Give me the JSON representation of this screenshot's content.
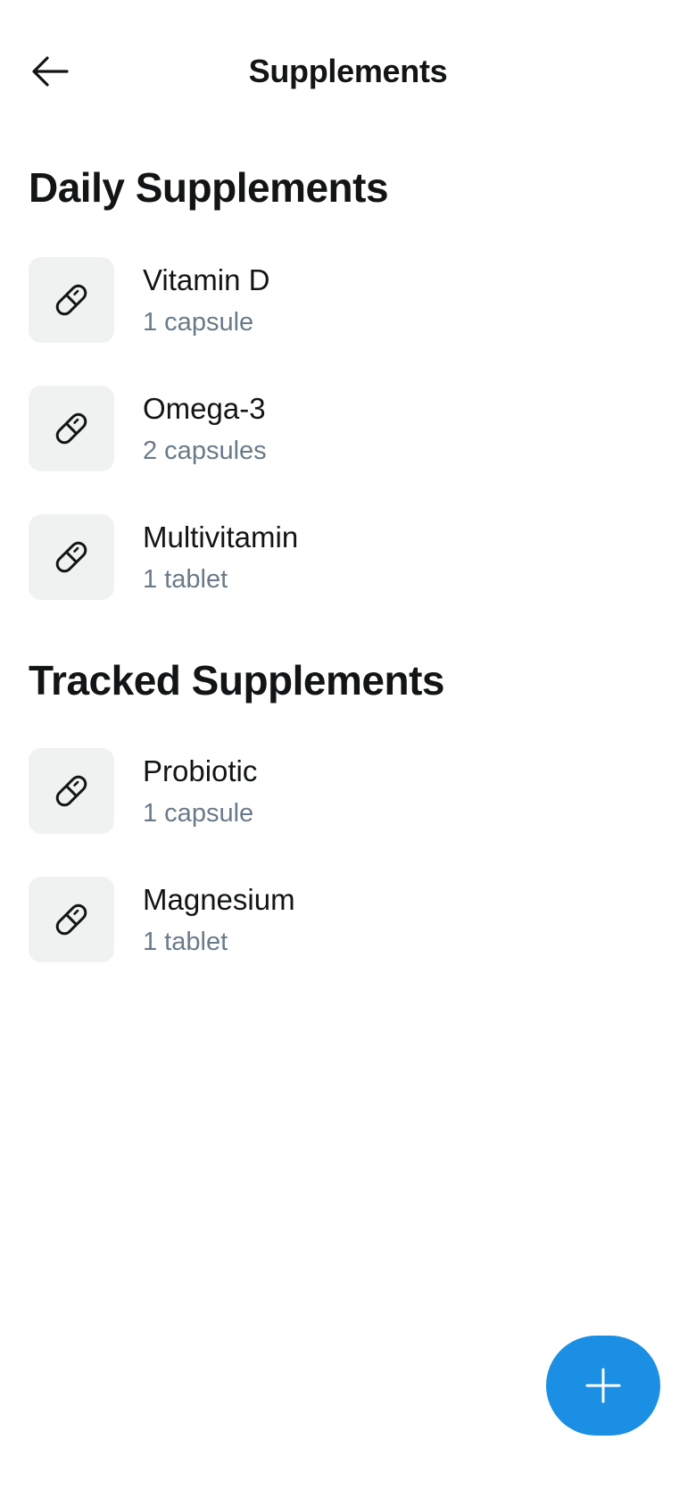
{
  "header": {
    "title": "Supplements",
    "back_icon": "arrow-left-icon"
  },
  "sections": [
    {
      "title": "Daily Supplements",
      "items": [
        {
          "name": "Vitamin D",
          "dose": "1 capsule",
          "icon": "pill-icon"
        },
        {
          "name": "Omega-3",
          "dose": "2 capsules",
          "icon": "pill-icon"
        },
        {
          "name": "Multivitamin",
          "dose": "1 tablet",
          "icon": "pill-icon"
        }
      ]
    },
    {
      "title": "Tracked Supplements",
      "items": [
        {
          "name": "Probiotic",
          "dose": "1 capsule",
          "icon": "pill-icon"
        },
        {
          "name": "Magnesium",
          "dose": "1 tablet",
          "icon": "pill-icon"
        }
      ]
    }
  ],
  "fab": {
    "icon": "plus-icon"
  },
  "colors": {
    "accent": "#1a8fe3",
    "icon_tile": "#f0f2f2",
    "secondary_text": "#6a7a88",
    "primary_text": "#121416"
  }
}
